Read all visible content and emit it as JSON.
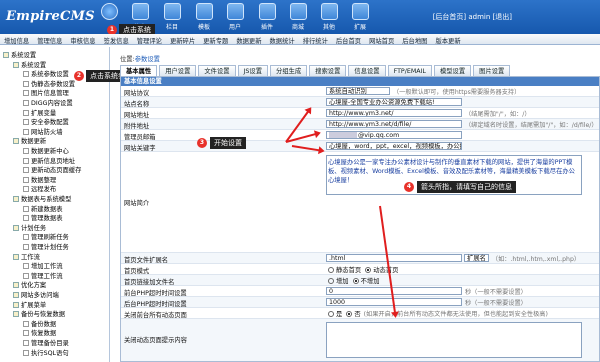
{
  "app": {
    "logo": "EmpireCMS"
  },
  "topnav": [
    {
      "label": "点击系统",
      "icon": "system-icon"
    },
    {
      "label": "信息",
      "icon": "edit-icon"
    },
    {
      "label": "栏目",
      "icon": "folder-icon"
    },
    {
      "label": "模板",
      "icon": "template-icon"
    },
    {
      "label": "用户",
      "icon": "user-icon"
    },
    {
      "label": "插件",
      "icon": "plugin-icon"
    },
    {
      "label": "商城",
      "icon": "shop-icon"
    },
    {
      "label": "其他",
      "icon": "other-icon"
    },
    {
      "label": "扩展",
      "icon": "extend-icon"
    }
  ],
  "toplinks": "[后台首页] admin [退出]",
  "subnav": [
    "增加信息",
    "管理信息",
    "审核信息",
    "签发信息",
    "管理评论",
    "更新碎片",
    "更新专题",
    "数据更新",
    "数据统计",
    "排行统计",
    "后台首页",
    "网站首页",
    "后台地图",
    "版本更新"
  ],
  "tree": [
    {
      "label": "系统设置",
      "level": 0
    },
    {
      "label": "系统设置",
      "level": 1
    },
    {
      "label": "系统参数设置",
      "level": 2
    },
    {
      "label": "伪静态参数设置",
      "level": 2
    },
    {
      "label": "图片信息管理",
      "level": 2
    },
    {
      "label": "DIGG内容设置",
      "level": 2
    },
    {
      "label": "扩展变量",
      "level": 2
    },
    {
      "label": "安全参数配置",
      "level": 2
    },
    {
      "label": "网站防火墙",
      "level": 2
    },
    {
      "label": "数据更新",
      "level": 1
    },
    {
      "label": "数据更新中心",
      "level": 2
    },
    {
      "label": "更新信息页地址",
      "level": 2
    },
    {
      "label": "更新动态页面缓存",
      "level": 2
    },
    {
      "label": "数据整理",
      "level": 2
    },
    {
      "label": "远程发布",
      "level": 2
    },
    {
      "label": "数据表与系统模型",
      "level": 1
    },
    {
      "label": "新建数据表",
      "level": 2
    },
    {
      "label": "管理数据表",
      "level": 2
    },
    {
      "label": "计划任务",
      "level": 1
    },
    {
      "label": "管理刷新任务",
      "level": 2
    },
    {
      "label": "管理计划任务",
      "level": 2
    },
    {
      "label": "工作流",
      "level": 1
    },
    {
      "label": "增加工作流",
      "level": 2
    },
    {
      "label": "管理工作流",
      "level": 2
    },
    {
      "label": "优化方案",
      "level": 1
    },
    {
      "label": "网站多访问端",
      "level": 1
    },
    {
      "label": "扩展菜单",
      "level": 1
    },
    {
      "label": "备份与恢复数据",
      "level": 1
    },
    {
      "label": "备份数据",
      "level": 2
    },
    {
      "label": "恢复数据",
      "level": 2
    },
    {
      "label": "管理备份目录",
      "level": 2
    },
    {
      "label": "执行SQL语句",
      "level": 2
    }
  ],
  "position": {
    "label": "位置:",
    "link": "参数设置"
  },
  "tabs": [
    "基本属性",
    "用户设置",
    "文件设置",
    "JS设置",
    "分组生成",
    "搜索设置",
    "信息设置",
    "FTP/EMAIL",
    "模型设置",
    "图片设置"
  ],
  "form_header": "基本信息设置",
  "fields": {
    "protocol": {
      "label": "网站协议",
      "value": "系统自动识别",
      "hint": "（一般默认即可，使用https需要服务器支持）"
    },
    "sitename": {
      "label": "站点名称",
      "value": "心境屋-全国专业办公资源免费下载站!"
    },
    "siteurl": {
      "label": "网站地址",
      "value": "http://www.ym3.net/",
      "hint": "（结尾需加\"/\"，如：/）"
    },
    "attachurl": {
      "label": "附件地址",
      "value": "http://www.ym3.net/d/file/",
      "hint": "（绑定域名时设置，结尾需加\"/\"，如：/d/file/）"
    },
    "email": {
      "label": "管理员邮箱",
      "value": "@vip.qq.com"
    },
    "keywords": {
      "label": "网站关键字",
      "value": "心境屋，word，ppt，excel，视频模板，办公技"
    },
    "description": {
      "label": "网站简介",
      "value": "心境屋办公是一家专注办公素材设计与制作的垂直素材下载的网站，提供了海量的PPT模板、视频素材、Word模板、Excel模板、音效及配乐素材等，海量精美模板下载尽在办公心境屋！"
    },
    "fileext": {
      "label": "首页文件扩展名",
      "value": ".html",
      "select": "扩展名",
      "hint": "（如：.html,.htm,.xml,.php）"
    },
    "homemode": {
      "label": "首页模式",
      "options": [
        "静态首页",
        "动态首页"
      ],
      "selected": 1
    },
    "homelink": {
      "label": "首页链接加文件名",
      "options": [
        "增加",
        "不增加"
      ],
      "selected": 1
    },
    "frontphp": {
      "label": "前台PHP超时时间设置",
      "value": "0",
      "hint": "秒（一般不需要设置）"
    },
    "backphp": {
      "label": "后台PHP超时时间设置",
      "value": "1000",
      "hint": "秒（一般不需要设置）"
    },
    "closedyn": {
      "label": "关闭前台所有动态页面",
      "options": [
        "是",
        "否"
      ],
      "selected": 1,
      "hint": "(如果开启，前台所有动态文件都无法使用，但也能起到安全性极高)"
    },
    "closemsg": {
      "label": "关闭动态页面提示内容",
      "value": ""
    }
  },
  "annotations": [
    {
      "num": "1",
      "text": "点击系统"
    },
    {
      "num": "2",
      "text": "点击系统参数设置"
    },
    {
      "num": "3",
      "text": "开始设置"
    },
    {
      "num": "4",
      "text": "箭头所指，请填写自己的信息"
    }
  ],
  "colors": {
    "topbar": "#1a63bb",
    "accent": "#e01e1e",
    "header": "#4a7fc4"
  }
}
